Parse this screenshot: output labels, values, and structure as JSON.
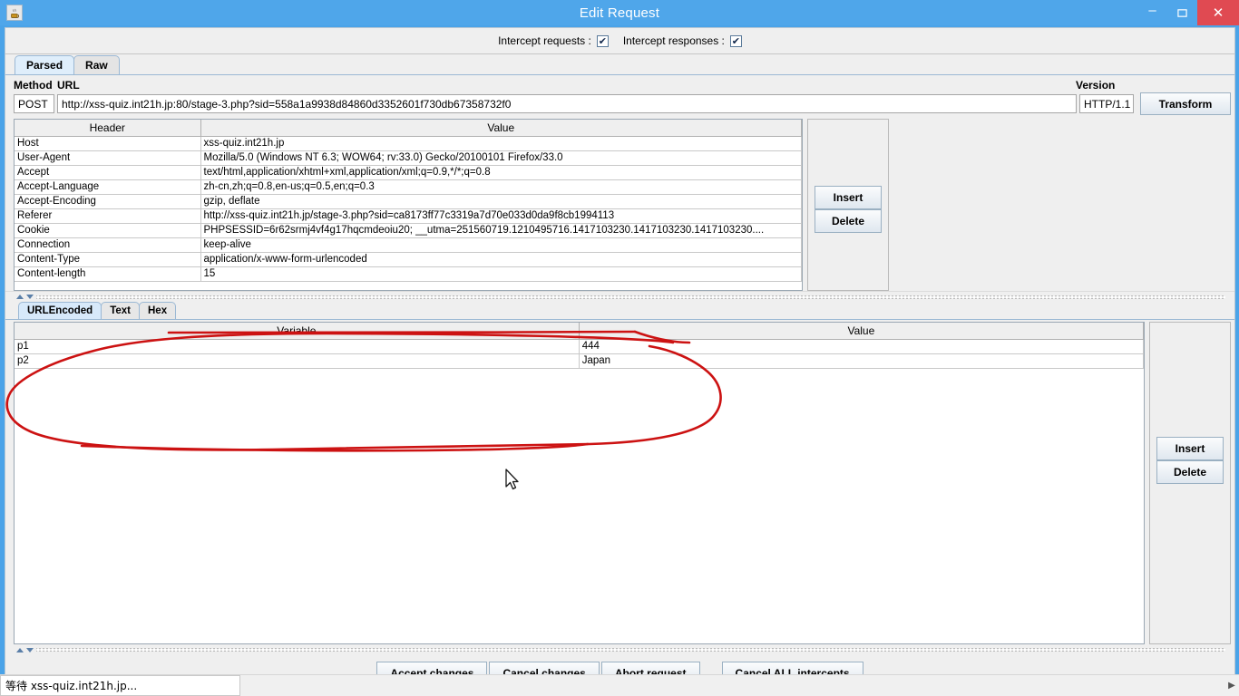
{
  "window": {
    "title": "Edit Request",
    "app_icon": "java-coffee-cup-icon",
    "minimize_label": "–",
    "maximize_label": "❐",
    "close_label": "✕",
    "accent_color": "#4fa6ea",
    "close_color": "#e04a52"
  },
  "intercept": {
    "requests_label": "Intercept requests :",
    "requests_checked": "✔",
    "responses_label": "Intercept responses :",
    "responses_checked": "✔"
  },
  "top_tabs": [
    {
      "label": "Parsed",
      "active": true
    },
    {
      "label": "Raw",
      "active": false
    }
  ],
  "request_line": {
    "method_label": "Method",
    "url_label": "URL",
    "version_label": "Version",
    "method_value": "POST",
    "url_value": "http://xss-quiz.int21h.jp:80/stage-3.php?sid=558a1a9938d84860d3352601f730db67358732f0",
    "version_value": "HTTP/1.1",
    "transform_label": "Transform"
  },
  "headers_table": {
    "columns": [
      "Header",
      "Value"
    ],
    "rows": [
      [
        "Host",
        "xss-quiz.int21h.jp"
      ],
      [
        "User-Agent",
        "Mozilla/5.0 (Windows NT 6.3; WOW64; rv:33.0) Gecko/20100101 Firefox/33.0"
      ],
      [
        "Accept",
        "text/html,application/xhtml+xml,application/xml;q=0.9,*/*;q=0.8"
      ],
      [
        "Accept-Language",
        "zh-cn,zh;q=0.8,en-us;q=0.5,en;q=0.3"
      ],
      [
        "Accept-Encoding",
        "gzip, deflate"
      ],
      [
        "Referer",
        "http://xss-quiz.int21h.jp/stage-3.php?sid=ca8173ff77c3319a7d70e033d0da9f8cb1994113"
      ],
      [
        "Cookie",
        "PHPSESSID=6r62srmj4vf4g17hqcmdeoiu20; __utma=251560719.1210495716.1417103230.1417103230.1417103230...."
      ],
      [
        "Connection",
        "keep-alive"
      ],
      [
        "Content-Type",
        "application/x-www-form-urlencoded"
      ],
      [
        "Content-length",
        "15"
      ]
    ]
  },
  "headers_side": {
    "insert_label": "Insert",
    "delete_label": "Delete"
  },
  "body_tabs": [
    {
      "label": "URLEncoded",
      "active": true
    },
    {
      "label": "Text",
      "active": false
    },
    {
      "label": "Hex",
      "active": false
    }
  ],
  "params_table": {
    "columns": [
      "Variable",
      "Value"
    ],
    "rows": [
      [
        "p1",
        "444"
      ],
      [
        "p2",
        "Japan"
      ]
    ]
  },
  "params_side": {
    "insert_label": "Insert",
    "delete_label": "Delete"
  },
  "bottom_buttons": [
    {
      "label": "Accept changes"
    },
    {
      "label": "Cancel changes"
    },
    {
      "label": "Abort request"
    },
    {
      "label": "Cancel ALL intercepts"
    }
  ],
  "statusbar": {
    "text": "等待 xss-quiz.int21h.jp...",
    "overflow_arrow": "▶"
  },
  "annotation": {
    "color": "#cc1212",
    "shape": "hand-drawn-ellipse"
  }
}
